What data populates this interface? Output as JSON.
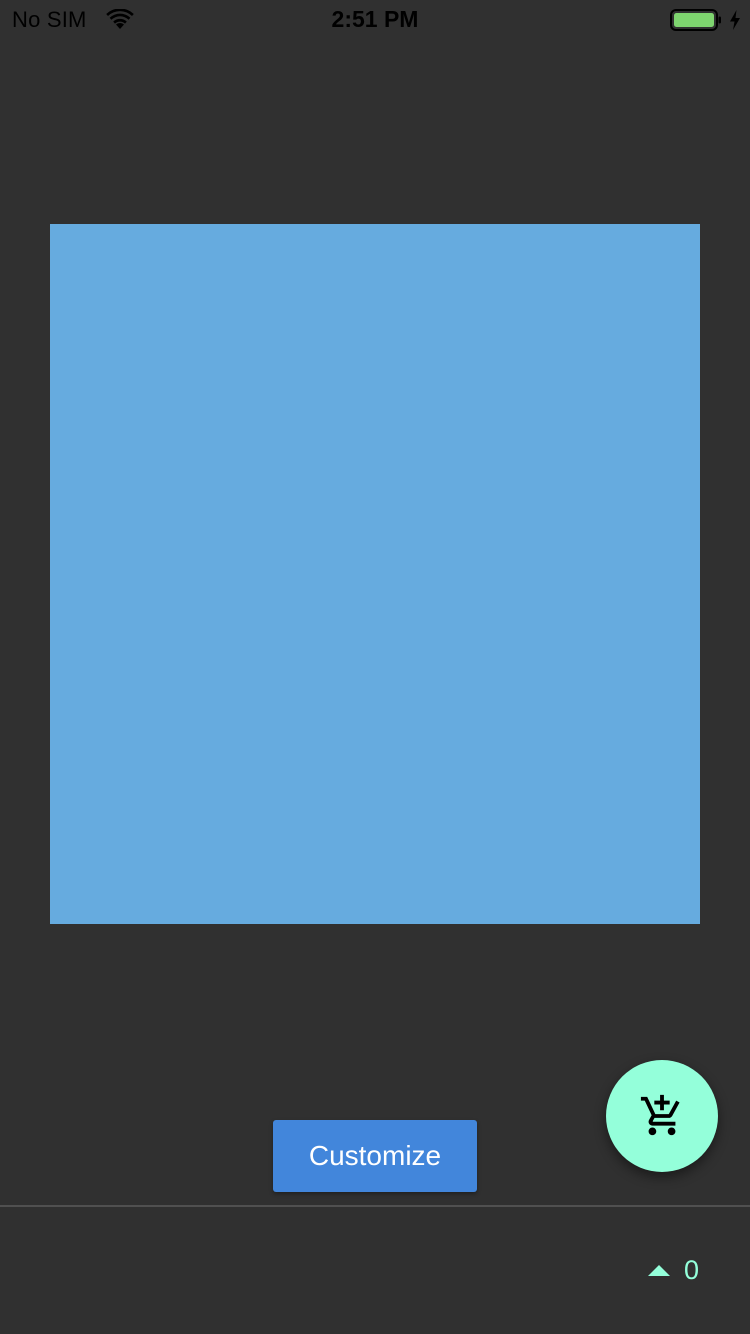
{
  "status_bar": {
    "carrier": "No SIM",
    "time": "2:51 PM",
    "icons": [
      "wifi-icon",
      "battery-icon",
      "charging-bolt-icon"
    ],
    "battery_color": "#7ED46F"
  },
  "preview": {
    "color": "#66ABDF"
  },
  "fab": {
    "icon": "add-shopping-cart-icon",
    "color": "#94FFDA"
  },
  "customize_button": {
    "label": "Customize",
    "color": "#4286DB"
  },
  "footer": {
    "icon": "arrow-up-icon",
    "count": "0",
    "accent": "#94FFDA",
    "divider_color": "#505050"
  }
}
